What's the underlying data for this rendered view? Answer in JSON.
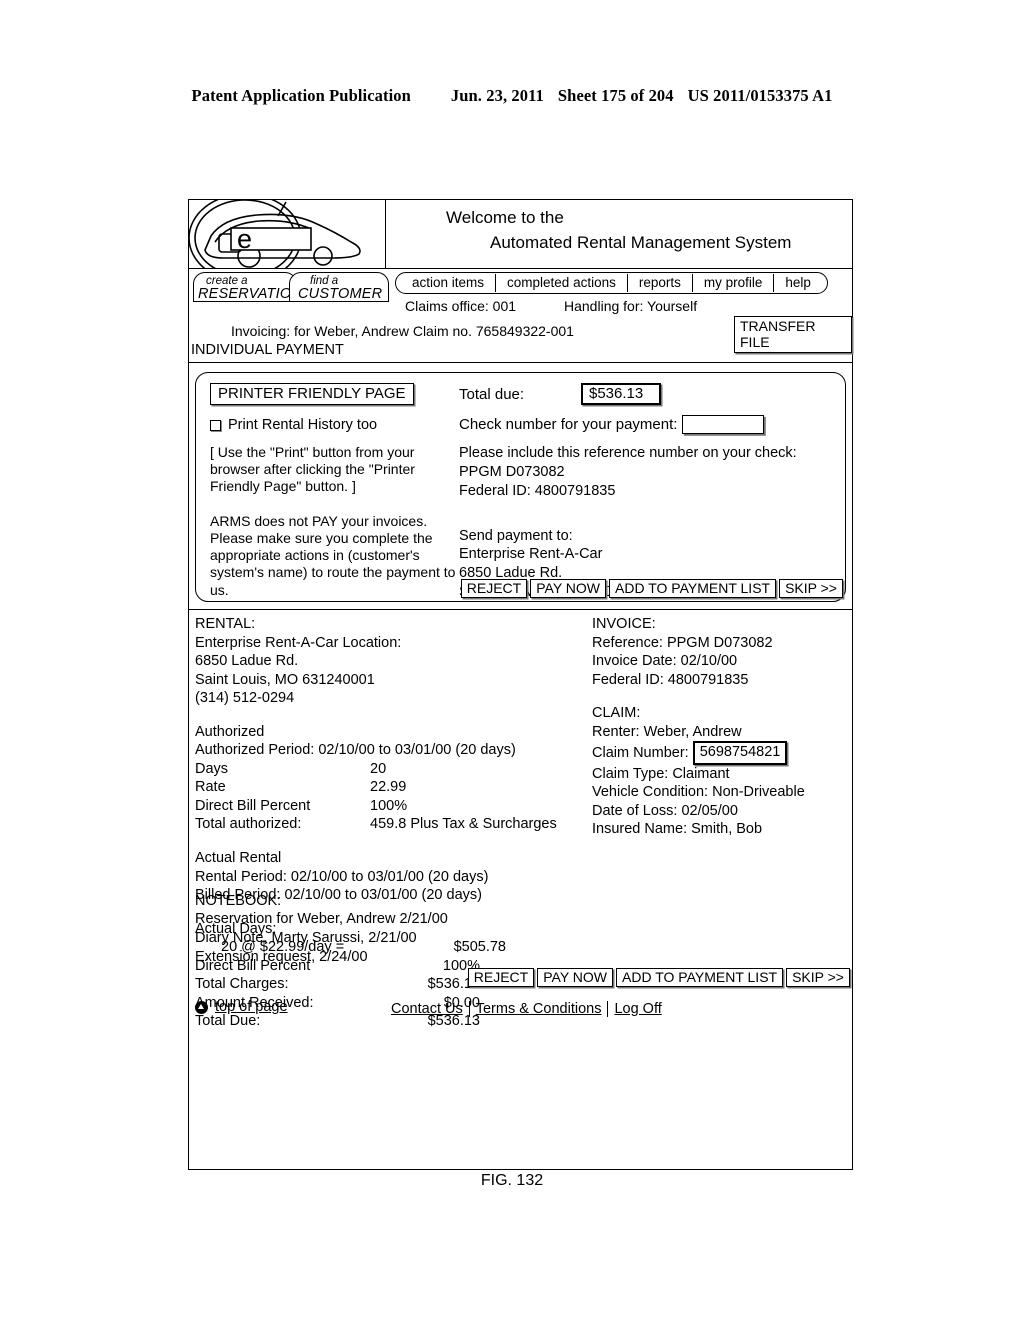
{
  "patent_header": {
    "publication": "Patent Application Publication",
    "date": "Jun. 23, 2011",
    "sheet": "Sheet 175 of 204",
    "number": "US 2011/0153375 A1"
  },
  "figure_caption": "FIG. 132",
  "banner": {
    "logo_letter": "e",
    "welcome_line1": "Welcome to the",
    "welcome_line2": "Automated Rental Management System"
  },
  "nav": {
    "tab_reservation_line1": "create a",
    "tab_reservation_line2": "RESERVATION",
    "tab_customer_line1": "find a",
    "tab_customer_line2": "CUSTOMER",
    "tabs": [
      {
        "label": "action items"
      },
      {
        "label": "completed actions"
      },
      {
        "label": "reports"
      },
      {
        "label": "my profile"
      },
      {
        "label": "help"
      }
    ],
    "claims_office": "Claims office: 001",
    "handling_for": "Handling for: Yourself",
    "transfer_file": "TRANSFER FILE",
    "invoicing": "Invoicing: for Weber, Andrew Claim no. 765849322-001",
    "page_title": "INDIVIDUAL PAYMENT"
  },
  "payment_panel": {
    "printer_friendly_button": "PRINTER FRIENDLY PAGE",
    "print_history_label": "Print Rental History too",
    "print_history_checked": false,
    "instruction_note": "[ Use the \"Print\" button from your browser after clicking the \"Printer Friendly Page\" button. ]",
    "arms_note": "ARMS does not PAY your invoices.  Please make sure you complete the appropriate actions in (customer's system's name) to route the payment to us.",
    "total_due_label": "Total due:",
    "total_due_value": "$536.13",
    "check_number_label": "Check number for your payment:",
    "check_number_value": "",
    "reference_instruction": "Please include this reference number on your check:",
    "reference_number": "PPGM D073082",
    "federal_id": "Federal ID: 4800791835",
    "send_payment_label": "Send payment to:",
    "send_payment_name": "Enterprise Rent-A-Car",
    "send_payment_street": "6850 Ladue Rd.",
    "send_payment_city": "St. Louis, MO 63124-0001",
    "buttons": [
      {
        "label": "REJECT"
      },
      {
        "label": "PAY NOW"
      },
      {
        "label": "ADD TO PAYMENT LIST"
      },
      {
        "label": "SKIP >>"
      }
    ]
  },
  "rental": {
    "heading": "RENTAL:",
    "location_label": "Enterprise Rent-A-Car Location:",
    "street": "6850 Ladue Rd.",
    "city": "Saint Louis, MO 631240001",
    "phone": "(314) 512-0294",
    "authorized_heading": "Authorized",
    "authorized_period": "Authorized Period: 02/10/00 to 03/01/00 (20 days)",
    "rows": [
      {
        "key": "Days",
        "value": "20"
      },
      {
        "key": "Rate",
        "value": "22.99"
      },
      {
        "key": "Direct Bill Percent",
        "value": "100%"
      },
      {
        "key": "Total authorized:",
        "value": "459.8 Plus Tax & Surcharges"
      }
    ],
    "actual_heading": "Actual Rental",
    "rental_period": "Rental Period: 02/10/00 to 03/01/00 (20 days)",
    "billed_period": "Billed Period: 02/10/00 to 03/01/00 (20 days)",
    "actual_days_heading": "Actual Days:",
    "charge_rows": [
      {
        "key": "20 @ $22.99/day =",
        "value": "$505.78",
        "indent": true
      },
      {
        "key": "Direct Bill Percent",
        "value": "100%",
        "indent": false
      },
      {
        "key": "Total Charges:",
        "value": "$536.13",
        "indent": false
      },
      {
        "key": "Amount Received:",
        "value": "$0.00",
        "indent": false
      },
      {
        "key": "Total Due:",
        "value": "$536.13",
        "indent": false
      }
    ]
  },
  "invoice": {
    "heading": "INVOICE:",
    "reference": "Reference: PPGM D073082",
    "invoice_date": "Invoice Date: 02/10/00",
    "federal_id": "Federal ID: 4800791835"
  },
  "claim": {
    "heading": "CLAIM:",
    "renter": "Renter: Weber, Andrew",
    "claim_number_label": "Claim Number:",
    "claim_number_value": "5698754821",
    "claim_type": "Claim Type: Claimant",
    "vehicle_condition": "Vehicle Condition: Non-Driveable",
    "date_of_loss": "Date of Loss: 02/05/00",
    "insured_name": "Insured Name: Smith, Bob"
  },
  "notebook": {
    "heading": "NOTEBOOK:",
    "entries": [
      "Reservation for Weber, Andrew 2/21/00",
      "Diary Note, Marty Sarussi, 2/21/00",
      "Extension request, 2/24/00"
    ]
  },
  "footer": {
    "top_of_page": "top of page",
    "links": [
      {
        "label": "Contact Us"
      },
      {
        "label": "Terms & Conditions"
      },
      {
        "label": "Log Off"
      }
    ],
    "buttons": [
      {
        "label": "REJECT"
      },
      {
        "label": "PAY NOW"
      },
      {
        "label": "ADD TO PAYMENT LIST"
      },
      {
        "label": "SKIP >>"
      }
    ]
  }
}
